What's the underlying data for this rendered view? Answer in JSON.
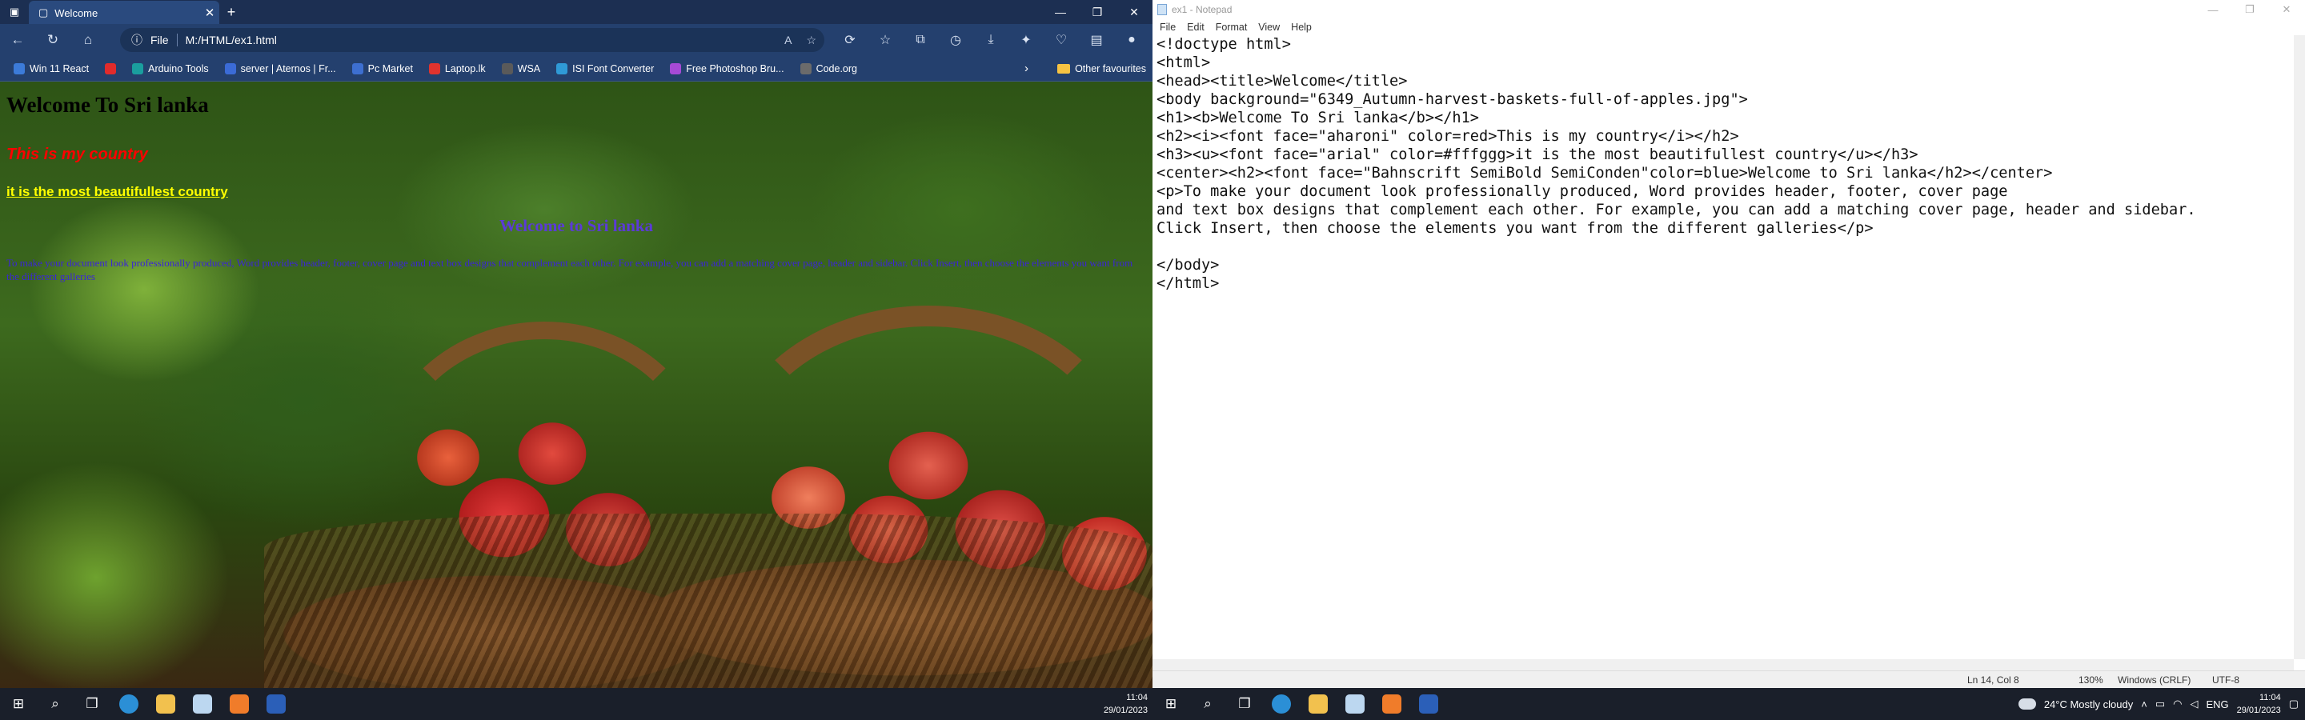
{
  "edge": {
    "tab_title": "Welcome",
    "tab_close": "✕",
    "new_tab": "+",
    "address_prefix": "File",
    "address_url": "M:/HTML/ex1.html",
    "window_controls": [
      "—",
      "❐",
      "✕"
    ],
    "favorites": [
      {
        "label": "Win 11 React",
        "color": "#3c7bd9"
      },
      {
        "label": "",
        "color": "#e12b2b"
      },
      {
        "label": "Arduino Tools",
        "color": "#1a9e9e"
      },
      {
        "label": "server | Aternos | Fr...",
        "color": "#3b6bd6"
      },
      {
        "label": "Pc Market",
        "color": "#3d6fd0"
      },
      {
        "label": "Laptop.lk",
        "color": "#e0332e"
      },
      {
        "label": "WSA",
        "color": "#5a5a5a"
      },
      {
        "label": "ISI Font Converter",
        "color": "#2f9ad6"
      },
      {
        "label": "Free Photoshop Bru...",
        "color": "#a64ad6"
      },
      {
        "label": "Code.org",
        "color": "#6b6b6b"
      }
    ],
    "other_favourites": "Other favourites"
  },
  "webpage": {
    "h1": "Welcome To Sri lanka",
    "h2": "This is my country",
    "h3": "it is the most beautifullest country",
    "center_h2": "Welcome to Sri lanka",
    "paragraph": "To make your document look professionally produced, Word provides header, footer, cover page and text box designs that complement each other. For example, you can add a matching cover page, header and sidebar. Click Insert, then choose the elements you want from the different galleries"
  },
  "taskbar_left": {
    "clock_time": "11:04",
    "clock_date": "29/01/2023"
  },
  "notepad": {
    "title": "ex1 - Notepad",
    "menu": [
      "File",
      "Edit",
      "Format",
      "View",
      "Help"
    ],
    "text": "<!doctype html>\n<html>\n<head><title>Welcome</title>\n<body background=\"6349_Autumn-harvest-baskets-full-of-apples.jpg\">\n<h1><b>Welcome To Sri lanka</b></h1>\n<h2><i><font face=\"aharoni\" color=red>This is my country</i></h2>\n<h3><u><font face=\"arial\" color=#fffggg>it is the most beautifullest country</u></h3>\n<center><h2><font face=\"Bahnscrift SemiBold SemiConden\"color=blue>Welcome to Sri lanka</h2></center>\n<p>To make your document look professionally produced, Word provides header, footer, cover page\nand text box designs that complement each other. For example, you can add a matching cover page, header and sidebar.\nClick Insert, then choose the elements you want from the different galleries</p>\n\n</body>\n</html>",
    "status": {
      "position": "Ln 14, Col 8",
      "zoom": "130%",
      "line_ending": "Windows (CRLF)",
      "encoding": "UTF-8"
    }
  },
  "taskbar_right": {
    "weather": "24°C  Mostly cloudy",
    "language": "ENG",
    "clock_time": "11:04",
    "clock_date": "29/01/2023"
  }
}
